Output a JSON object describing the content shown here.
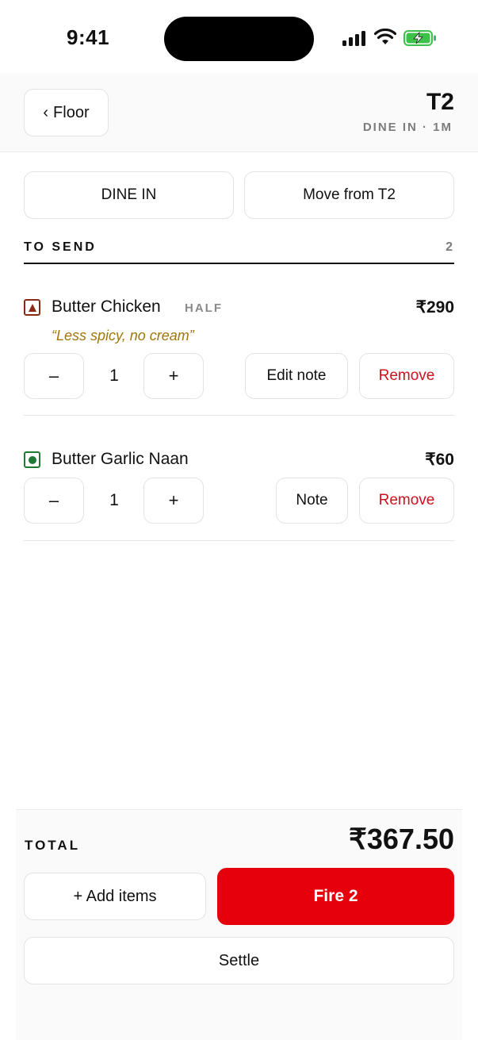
{
  "status_bar": {
    "time": "9:41"
  },
  "header": {
    "back_label": "Floor",
    "table": "T2",
    "meta": "DINE IN · 1M"
  },
  "order_actions": {
    "order_type": "DINE IN",
    "move_label": "Move from T2"
  },
  "section": {
    "title": "TO SEND",
    "count": "2"
  },
  "items": [
    {
      "name": "Butter Chicken",
      "variant": "HALF",
      "price": "₹290",
      "note": "“Less spicy, no cream”",
      "qty": "1",
      "note_button": "Edit note",
      "remove_button": "Remove",
      "food_type": "non-veg"
    },
    {
      "name": "Butter Garlic Naan",
      "price": "₹60",
      "qty": "1",
      "note_button": "Note",
      "remove_button": "Remove",
      "food_type": "veg"
    }
  ],
  "stepper": {
    "minus": "–",
    "plus": "+"
  },
  "footer": {
    "total_label": "TOTAL",
    "total_amount": "₹367.50",
    "add_items": "+ Add items",
    "fire": "Fire 2",
    "settle": "Settle"
  },
  "colors": {
    "accent": "#e5000c",
    "remove_text": "#d0101f",
    "note_text": "#a07608",
    "veg": "#1f7a33",
    "non_veg": "#8a2a12"
  }
}
